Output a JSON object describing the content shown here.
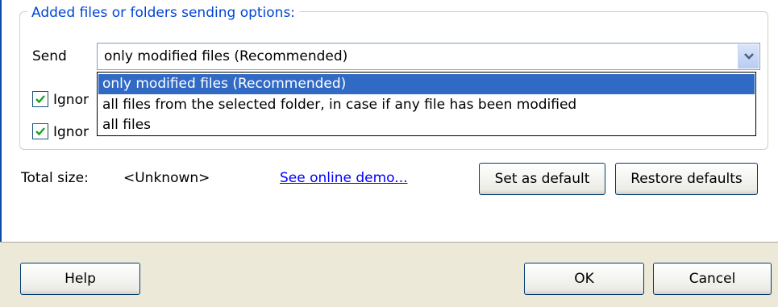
{
  "group": {
    "title": "Added files or folders sending options:",
    "send_label": "Send",
    "send_combo": {
      "value": "only modified files (Recommended)",
      "options": [
        "only modified files (Recommended)",
        "all files from the selected folder, in case if any file has been modified",
        "all files"
      ],
      "selected_index": 0
    },
    "checkboxes": [
      {
        "label": "Ignor",
        "checked": true
      },
      {
        "label": "Ignor",
        "checked": true
      }
    ]
  },
  "totals": {
    "label": "Total size:",
    "value": "<Unknown>"
  },
  "demo_link": "See online demo...",
  "buttons": {
    "set_default": "Set as default",
    "restore_defaults": "Restore defaults",
    "help": "Help",
    "ok": "OK",
    "cancel": "Cancel"
  },
  "colors": {
    "legend": "#0046d5",
    "selection": "#316ac5",
    "link": "#0000ff",
    "button_bar": "#ece9d8"
  },
  "icons": {
    "combo_button": "chevron-down-icon",
    "checkbox": "checkmark-icon"
  }
}
